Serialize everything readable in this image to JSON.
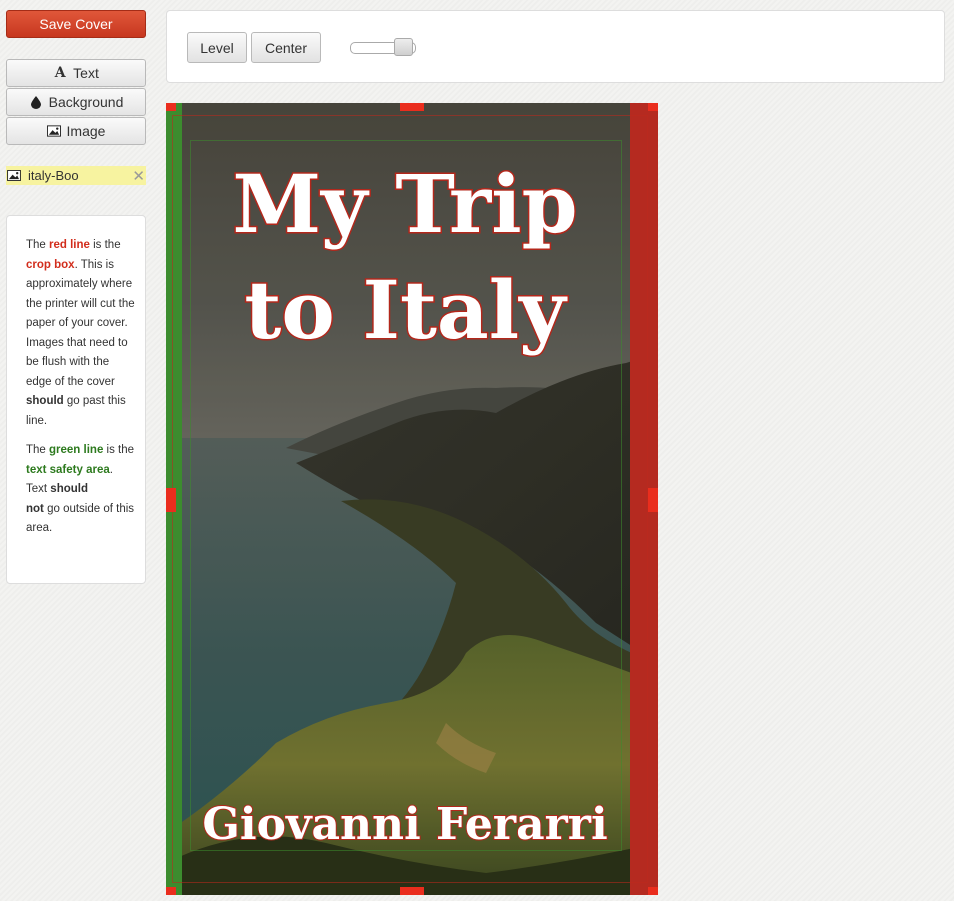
{
  "sidebar": {
    "save_label": "Save Cover",
    "tools": [
      {
        "label": "Text",
        "icon": "text-a-icon"
      },
      {
        "label": "Background",
        "icon": "droplet-icon"
      },
      {
        "label": "Image",
        "icon": "image-icon"
      }
    ],
    "layer": {
      "label": "italy-Boo",
      "icon": "image-icon",
      "remove_icon": "close-x-icon"
    },
    "info": {
      "p1": {
        "t1": "The ",
        "red_line": "red line",
        "t2": " is the ",
        "crop_box": "crop box",
        "t3": ". This is approximately where the printer will cut the paper of your cover. Images that need to be flush with the edge of the cover ",
        "should": "should",
        "t4": " go past this line."
      },
      "p2": {
        "t1": "The ",
        "green_line": "green line",
        "t2": " is the ",
        "text_safety_area": "text safety area",
        "t3": ". Text ",
        "should_not_1": "should",
        "should_not_2": "not",
        "t4": " go outside of this area."
      }
    }
  },
  "toolbar": {
    "level_label": "Level",
    "center_label": "Center",
    "slider_value": 0.85
  },
  "cover": {
    "title_line1": "My Trip",
    "title_line2": "to Italy",
    "author": "Giovanni Ferarri",
    "colors": {
      "crop_box": "#d22d1c",
      "text_safety": "#3c8c2e",
      "title_fill": "#ffffff",
      "title_outline": "#b3271b",
      "save_button": "#d9452b"
    }
  }
}
